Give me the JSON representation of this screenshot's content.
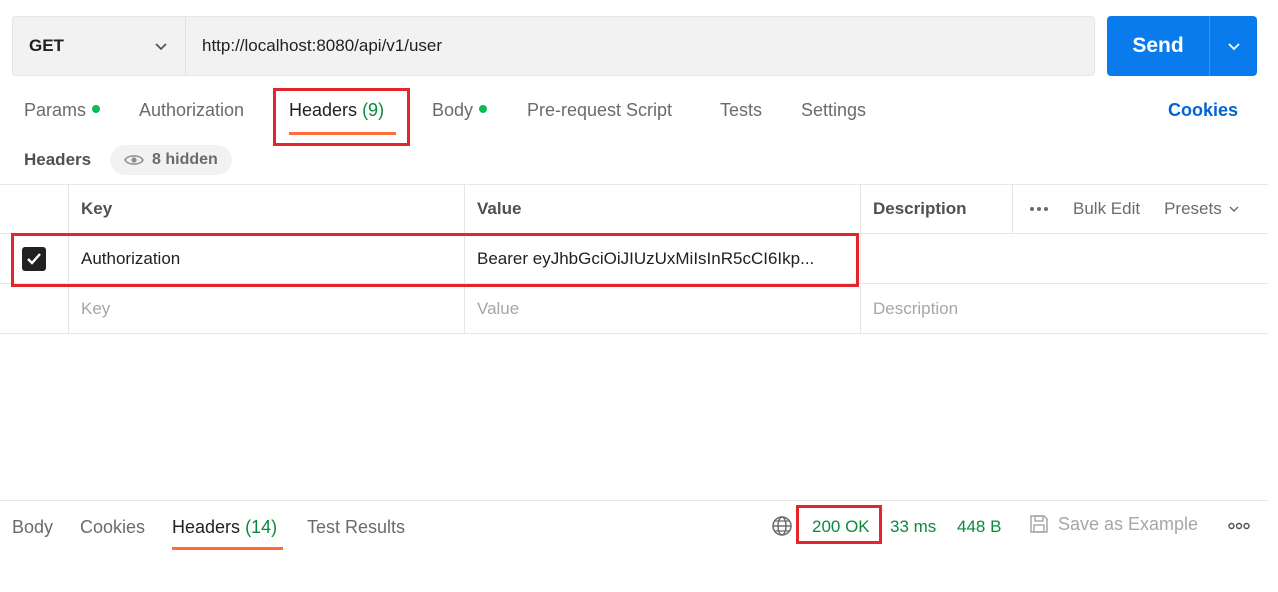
{
  "request": {
    "method": "GET",
    "url": "http://localhost:8080/api/v1/user",
    "send_label": "Send"
  },
  "tabs": {
    "params": "Params",
    "authorization": "Authorization",
    "headers": "Headers",
    "headers_count": "(9)",
    "body": "Body",
    "prerequest": "Pre-request Script",
    "tests": "Tests",
    "settings": "Settings",
    "cookies": "Cookies"
  },
  "headers_section": {
    "title": "Headers",
    "hidden_label": "8 hidden"
  },
  "table": {
    "columns": {
      "key": "Key",
      "value": "Value",
      "description": "Description"
    },
    "bulk_edit": "Bulk Edit",
    "presets": "Presets",
    "rows": [
      {
        "checked": true,
        "key": "Authorization",
        "value": "Bearer eyJhbGciOiJIUzUxMiIsInR5cCI6Ikp..."
      }
    ],
    "placeholders": {
      "key": "Key",
      "value": "Value",
      "description": "Description"
    }
  },
  "response": {
    "tabs": {
      "body": "Body",
      "cookies": "Cookies",
      "headers": "Headers",
      "headers_count": "(14)",
      "test_results": "Test Results"
    },
    "status": "200 OK",
    "time": "33 ms",
    "size": "448 B",
    "save_example": "Save as Example"
  },
  "colors": {
    "send_blue": "#097bed",
    "active_tab_orange": "#ff6c37",
    "success_green": "#0a8a3b",
    "status_dot_green": "#0cbb52",
    "highlight_red": "#e3262e",
    "cookies_link_blue": "#0265d2"
  },
  "icons": {
    "method_dropdown": "chevron-down-icon",
    "send_dropdown": "chevron-down-icon",
    "hidden_toggle": "eye-icon",
    "row_checkbox": "checkmark-icon",
    "table_more": "ellipsis-icon",
    "presets_dropdown": "chevron-down-icon",
    "network": "globe-icon",
    "save": "save-icon",
    "response_more": "ellipsis-icon"
  }
}
